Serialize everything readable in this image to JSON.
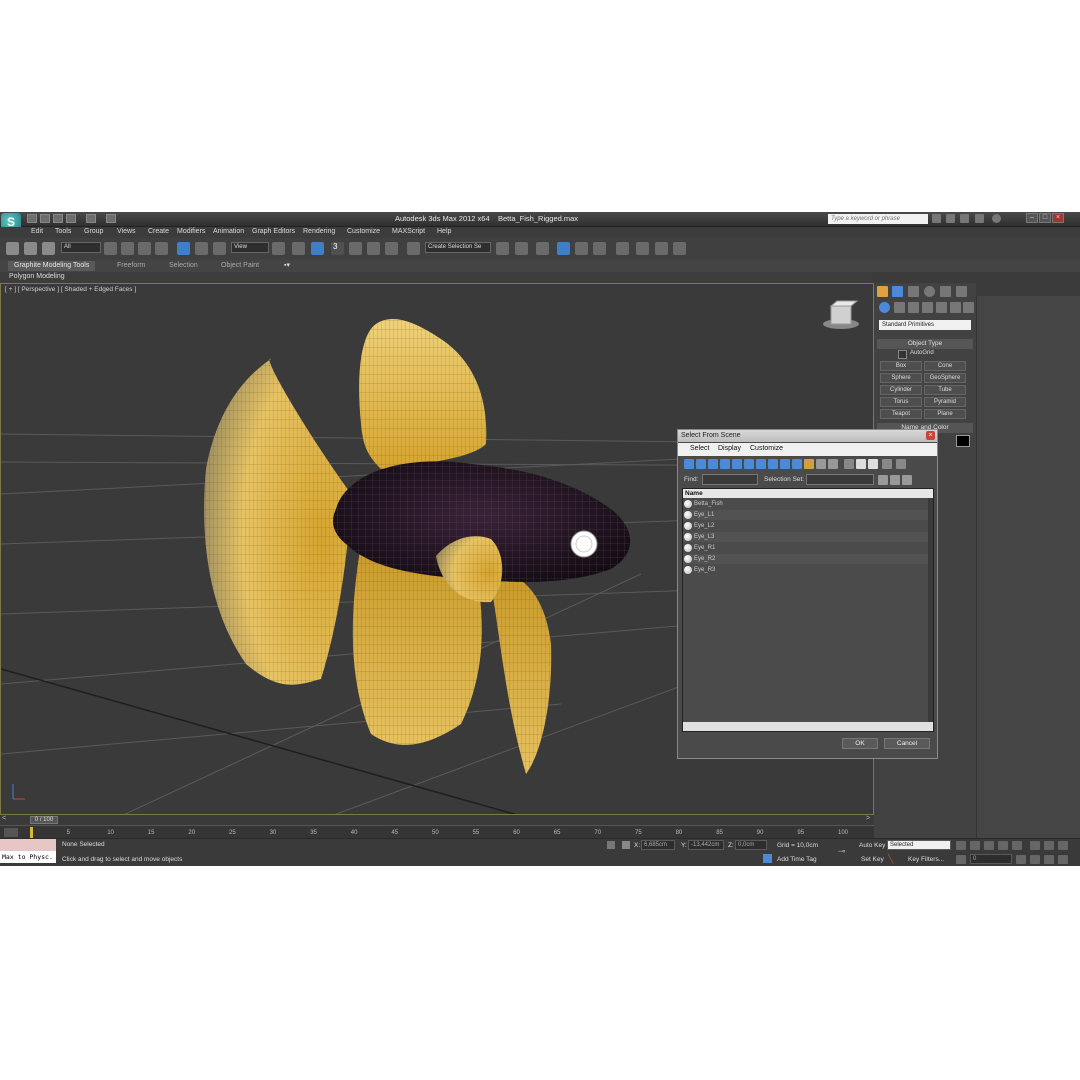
{
  "window": {
    "title": "Autodesk 3ds Max  2012 x64",
    "filename": "Betta_Fish_Rigged.max",
    "search_placeholder": "Type a keyword or phrase"
  },
  "menu": [
    "Edit",
    "Tools",
    "Group",
    "Views",
    "Create",
    "Modifiers",
    "Animation",
    "Graph Editors",
    "Rendering",
    "Customize",
    "MAXScript",
    "Help"
  ],
  "toolbar": {
    "selection_filter": "All",
    "ref_coord": "View",
    "named_selection_set": "Create Selection Se",
    "snap_label": "3"
  },
  "ribbon": {
    "tabs": [
      "Graphite Modeling Tools",
      "Freeform",
      "Selection",
      "Object Paint"
    ],
    "active_tab": "Graphite Modeling Tools",
    "sub_label": "Polygon Modeling"
  },
  "viewport": {
    "label": "[ + ] [ Perspective ] [ Shaded + Edged Faces ]"
  },
  "command_panel": {
    "category": "Standard Primitives",
    "object_type_title": "Object Type",
    "autogrid": "AutoGrid",
    "buttons": [
      "Box",
      "Cone",
      "Sphere",
      "GeoSphere",
      "Cylinder",
      "Tube",
      "Torus",
      "Pyramid",
      "Teapot",
      "Plane"
    ],
    "name_color_title": "Name and Color"
  },
  "dialog": {
    "title": "Select From Scene",
    "menu": [
      "Select",
      "Display",
      "Customize"
    ],
    "find_label": "Find:",
    "selection_set_label": "Selection Set:",
    "column_header": "Name",
    "items": [
      "Betta_Fish",
      "Eye_L1",
      "Eye_L2",
      "Eye_L3",
      "Eye_R1",
      "Eye_R2",
      "Eye_R3"
    ],
    "ok_label": "OK",
    "cancel_label": "Cancel"
  },
  "timeline": {
    "frame_counter": "0 / 100",
    "ticks": [
      "5",
      "10",
      "15",
      "20",
      "25",
      "30",
      "35",
      "40",
      "45",
      "50",
      "55",
      "60",
      "65",
      "70",
      "75",
      "80",
      "85",
      "90",
      "95",
      "100"
    ]
  },
  "status": {
    "maxscript": "Max to Physc.",
    "selection": "None Selected",
    "prompt": "Click and drag to select and move objects",
    "x_label": "X:",
    "x_value": "6,685cm",
    "y_label": "Y:",
    "y_value": "-13,442cm",
    "z_label": "Z:",
    "z_value": "0,0cm",
    "grid": "Grid = 10,0cm",
    "add_time_tag": "Add Time Tag",
    "auto_key": "Auto Key",
    "set_key": "Set Key",
    "key_mode": "Selected",
    "key_filters": "Key Filters...",
    "frame_value": "0"
  },
  "colors": {
    "fin_yellow": "#e8b83a",
    "body_dark": "#2a1a2a",
    "accent_blue": "#3e7fc9"
  }
}
